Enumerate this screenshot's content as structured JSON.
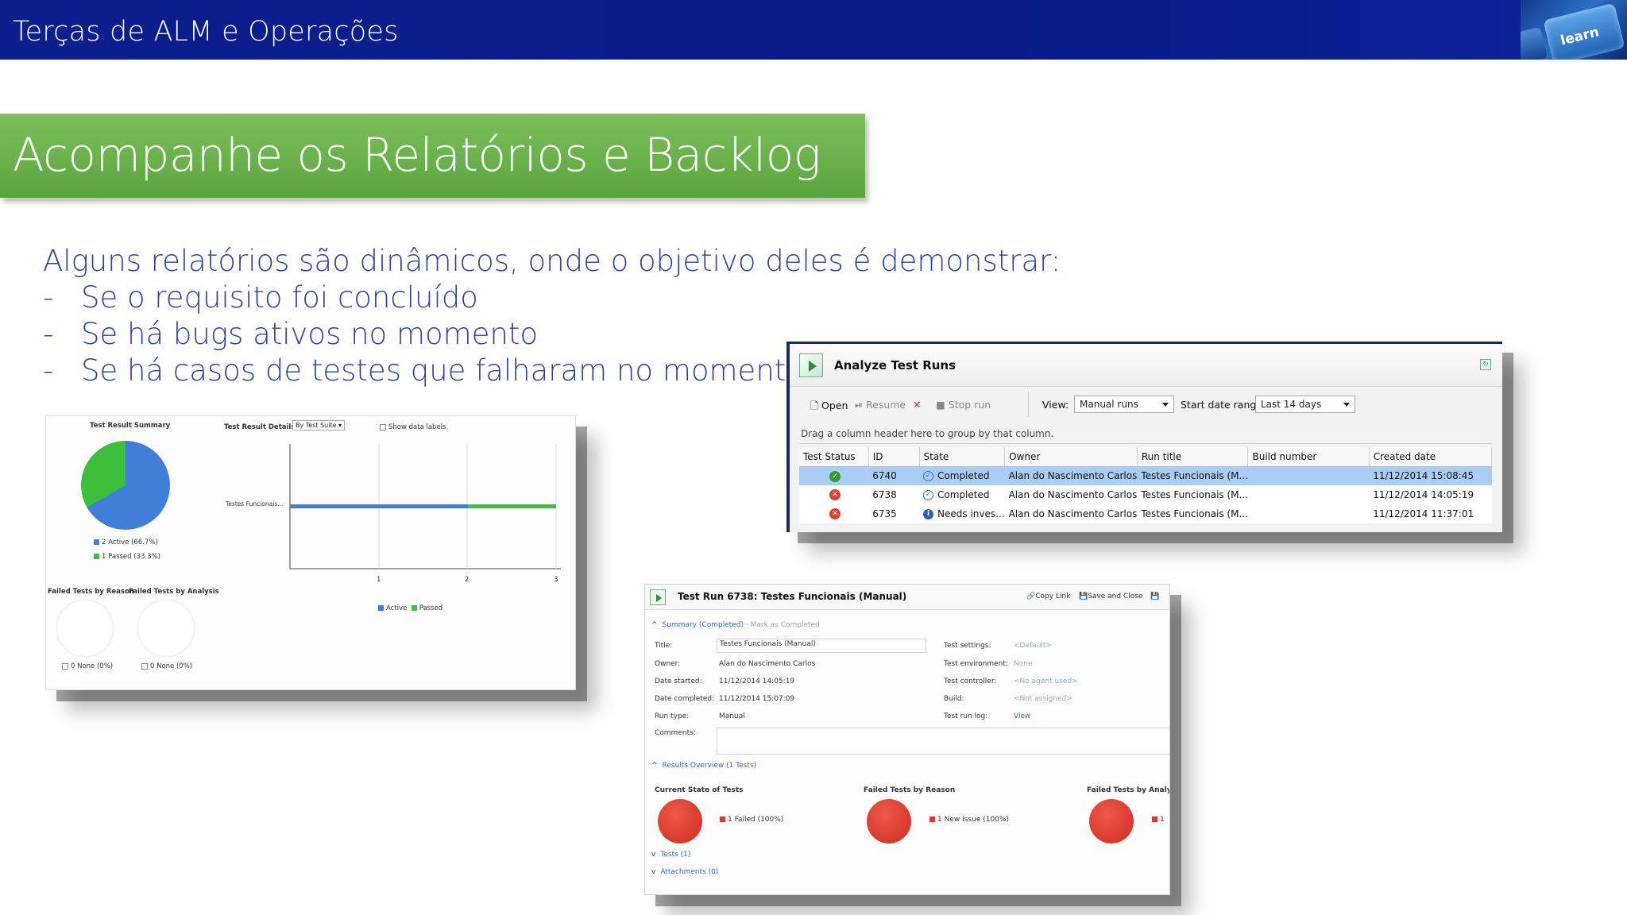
{
  "header": {
    "title": "Terças de ALM e Operações",
    "key_label": "learn"
  },
  "banner": {
    "title": "Acompanhe os Relatórios e Backlog"
  },
  "intro": {
    "lead": "Alguns relatórios são dinâmicos, onde o objetivo deles é demonstrar:",
    "bullet_marker": "-",
    "bullets": [
      "Se o requisito foi concluído",
      "Se há bugs ativos no momento",
      "Se há casos de testes que falharam no momento"
    ]
  },
  "dashboard": {
    "summary_title": "Test Result Summary",
    "details_title": "Test Result Details",
    "details_dropdown": "By Test Suite",
    "show_labels": "Show data labels",
    "legend": [
      "2 Active (66.7%)",
      "1 Passed (33.3%)"
    ],
    "bar_label": "Testes Funcionais...",
    "x_ticks": [
      "1",
      "2",
      "3"
    ],
    "series_legend": [
      "Active",
      "Passed"
    ],
    "failed_reason": "Failed Tests by Reason",
    "failed_analysis": "Failed Tests by Analysis",
    "none_1": "0 None (0%)",
    "none_2": "0 None (0%)",
    "colors": {
      "active": "#3f7fd9",
      "passed": "#3cc03c"
    },
    "chart_data": {
      "type": "pie",
      "categories": [
        "Active",
        "Passed"
      ],
      "values": [
        2,
        1
      ],
      "title": "Test Result Summary"
    }
  },
  "analyze": {
    "title": "Analyze Test Runs",
    "toolbar": {
      "open": "Open",
      "resume": "Resume",
      "stop": "Stop run",
      "view_label": "View:",
      "view_value": "Manual runs",
      "date_label": "Start date range:",
      "date_value": "Last 14 days"
    },
    "group_hint": "Drag a column header here to group by that column.",
    "columns": [
      "Test Status",
      "ID",
      "State",
      "Owner",
      "Run title",
      "Build number",
      "Created date"
    ],
    "rows": [
      {
        "status": "pass",
        "id": "6740",
        "state": "Completed",
        "owner": "Alan do Nascimento Carlos",
        "title": "Testes Funcionais (M...",
        "build": "",
        "created": "11/12/2014 15:08:45"
      },
      {
        "status": "fail",
        "id": "6738",
        "state": "Completed",
        "owner": "Alan do Nascimento Carlos",
        "title": "Testes Funcionais (M...",
        "build": "",
        "created": "11/12/2014 14:05:19"
      },
      {
        "status": "fail",
        "id": "6735",
        "state": "Needs inves...",
        "owner": "Alan do Nascimento Carlos",
        "title": "Testes Funcionais (M...",
        "build": "",
        "created": "11/12/2014 11:37:01"
      }
    ]
  },
  "testrun": {
    "title": "Test Run 6738: Testes Funcionais (Manual)",
    "copy_link": "Copy Link",
    "save_close": "Save and Close",
    "summary": "Summary",
    "completed": "Completed",
    "mark_completed": "Mark as Completed",
    "labels": {
      "title": "Title:",
      "owner": "Owner:",
      "date_started": "Date started:",
      "date_completed": "Date completed:",
      "run_type": "Run type:",
      "comments": "Comments:",
      "settings": "Test settings:",
      "environment": "Test environment:",
      "controller": "Test controller:",
      "build": "Build:",
      "log": "Test run log:"
    },
    "values": {
      "title": "Testes Funcionais (Manual)",
      "owner": "Alan do Nascimento Carlos",
      "date_started": "11/12/2014 14:05:19",
      "date_completed": "11/12/2014 15:07:09",
      "run_type": "Manual",
      "settings": "<Default>",
      "environment": "None",
      "controller": "<No agent used>",
      "build": "<Not assigned>",
      "log": "View"
    },
    "results_overview": "Results Overview (1 Tests)",
    "charts": [
      {
        "title": "Current State of Tests",
        "legend": "1 Failed (100%)"
      },
      {
        "title": "Failed Tests by Reason",
        "legend": "1 New Issue (100%)"
      },
      {
        "title": "Failed Tests by Analysis",
        "legend": "1"
      }
    ],
    "tests": "Tests (1)",
    "attachments": "Attachments (0)"
  }
}
